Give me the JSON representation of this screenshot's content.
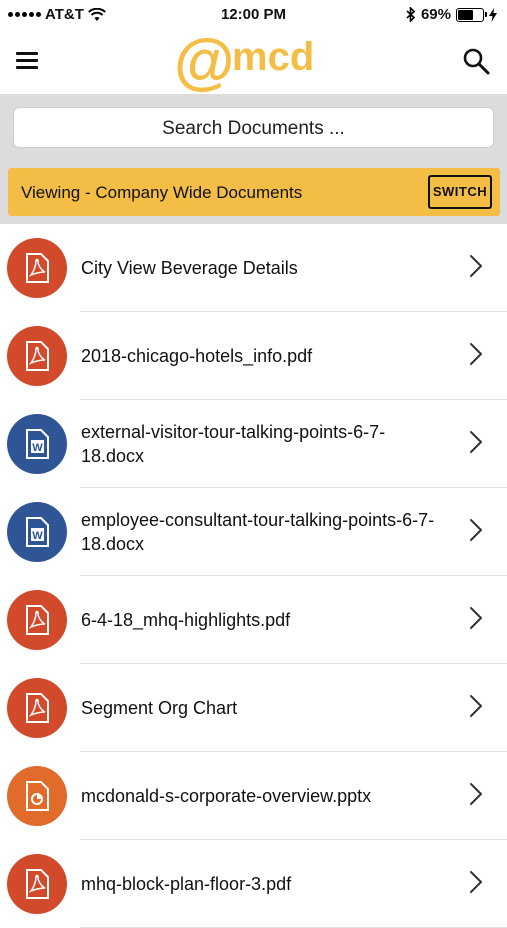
{
  "status": {
    "carrier": "AT&T",
    "time": "12:00 PM",
    "battery": "69%",
    "battery_level": 0.69
  },
  "header": {
    "logo_at": "@",
    "logo_text": "mcd",
    "logo_color": "#f3bd46",
    "menu_icon": "hamburger-menu-icon",
    "search_icon": "magnifier-icon"
  },
  "search": {
    "placeholder": "Search Documents ..."
  },
  "viewing": {
    "label": "Viewing - Company Wide Documents",
    "switch_label": "SWITCH"
  },
  "colors": {
    "pdf": "#d24a2c",
    "word": "#2f5597",
    "ppt": "#e06b2a"
  },
  "documents": [
    {
      "name": "City View Beverage Details",
      "type": "pdf"
    },
    {
      "name": "2018-chicago-hotels_info.pdf",
      "type": "pdf"
    },
    {
      "name": "external-visitor-tour-talking-points-6-7-18.docx",
      "type": "word"
    },
    {
      "name": "employee-consultant-tour-talking-points-6-7-18.docx",
      "type": "word"
    },
    {
      "name": "6-4-18_mhq-highlights.pdf",
      "type": "pdf"
    },
    {
      "name": "Segment Org Chart",
      "type": "pdf"
    },
    {
      "name": "mcdonald-s-corporate-overview.pptx",
      "type": "ppt"
    },
    {
      "name": "mhq-block-plan-floor-3.pdf",
      "type": "pdf"
    }
  ]
}
